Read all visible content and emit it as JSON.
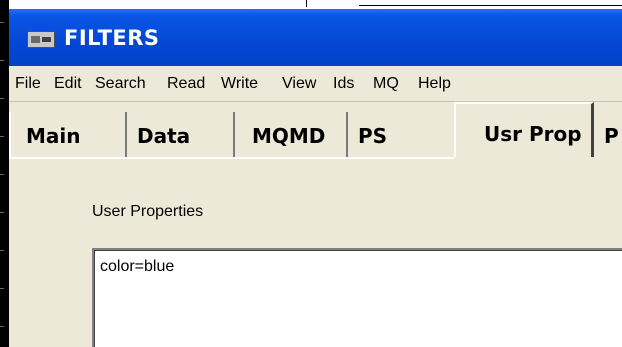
{
  "window": {
    "title": "FILTERS",
    "app_icon": "app-window-icon"
  },
  "menu": {
    "items": [
      "File",
      "Edit",
      "Search",
      "Read",
      "Write",
      "View",
      "Ids",
      "MQ",
      "Help"
    ]
  },
  "tabs": {
    "items": [
      "Main",
      "Data",
      "MQMD",
      "PS",
      "Usr Prop",
      "P"
    ],
    "active": "Usr Prop"
  },
  "user_properties": {
    "label": "User Properties",
    "value": "color=blue"
  },
  "colors": {
    "titlebar": "#0548d6",
    "face": "#ece9d8"
  }
}
